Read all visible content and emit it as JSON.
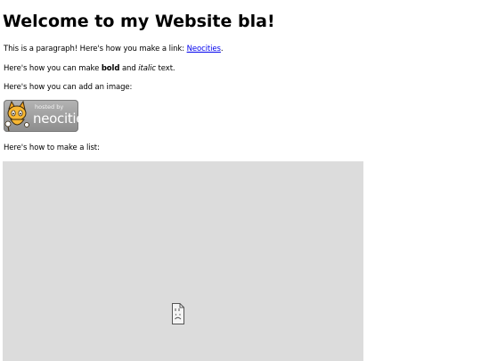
{
  "page": {
    "heading": "Welcome to my Website bla!",
    "p1_text": "This is a paragraph! Here's how you make a link: ",
    "p1_link": "Neocities",
    "p1_end": ".",
    "p2_start": "Here's how you can make ",
    "p2_bold": "bold",
    "p2_mid": " and ",
    "p2_italic": "italic",
    "p2_end": " text.",
    "p3_text": "Here's how you can add an image:",
    "p4_text": "Here's how to make a list:"
  },
  "badge": {
    "hosted_text": "hosted by",
    "brand_text": "neocities",
    "icon": "neocities-cat-logo"
  },
  "embed": {
    "icon": "broken-plugin-icon",
    "background": "#dcdcdc"
  },
  "colors": {
    "link": "#0000ee",
    "text": "#000000"
  }
}
